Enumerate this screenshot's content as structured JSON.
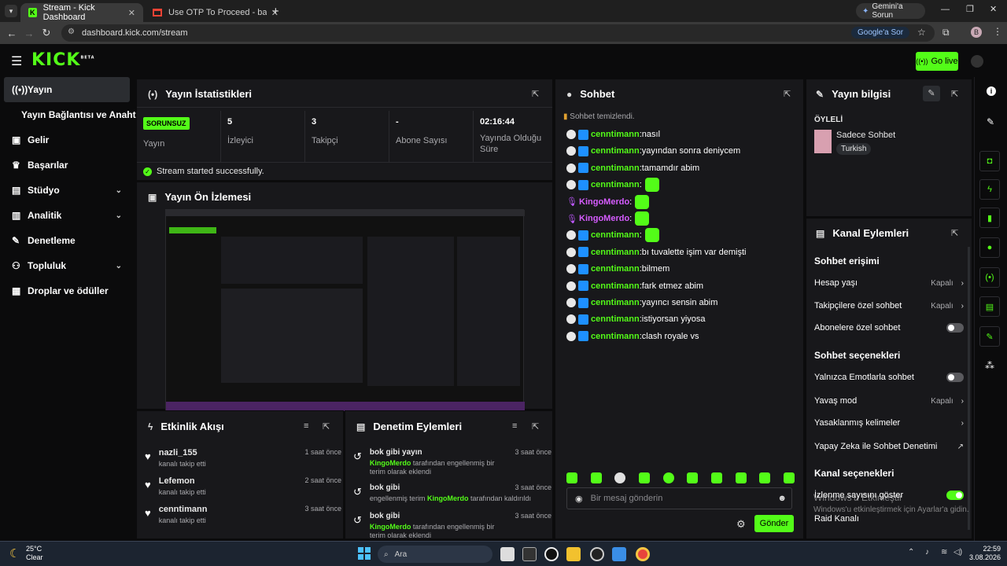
{
  "browser": {
    "tabs": [
      {
        "title": "Stream - Kick Dashboard"
      },
      {
        "title": "Use OTP To Proceed - babanne"
      }
    ],
    "gemini_button": "Gemini'a Sorun",
    "url": "dashboard.kick.com/stream",
    "google_pill": "Google'a Sor",
    "profile_initial": "B"
  },
  "header": {
    "logo": "KICK",
    "logo_beta": "BETA",
    "go_live": "Go live"
  },
  "sidebar": {
    "items": [
      {
        "label": "Yayın",
        "icon": "broadcast-icon"
      },
      {
        "label": "Yayın Bağlantısı ve Anahtarı",
        "icon": ""
      },
      {
        "label": "Gelir",
        "icon": "wallet-icon"
      },
      {
        "label": "Başarılar",
        "icon": "trophy-icon"
      },
      {
        "label": "Stüdyo",
        "icon": "studio-icon"
      },
      {
        "label": "Analitik",
        "icon": "chart-icon"
      },
      {
        "label": "Denetleme",
        "icon": "wrench-icon"
      },
      {
        "label": "Topluluk",
        "icon": "community-icon"
      },
      {
        "label": "Droplar ve ödüller",
        "icon": "gift-icon"
      }
    ]
  },
  "stats": {
    "title": "Yayın İstatistikleri",
    "status_badge": "SORUNSUZ",
    "status_label": "Yayın",
    "viewers": {
      "value": "5",
      "label": "İzleyici"
    },
    "followers": {
      "value": "3",
      "label": "Takipçi"
    },
    "subs": {
      "value": "-",
      "label": "Abone Sayısı"
    },
    "uptime": {
      "value": "02:16:44",
      "label": "Yayında Olduğu Süre"
    },
    "success": "Stream started successfully."
  },
  "preview": {
    "title": "Yayın Ön İzlemesi"
  },
  "activity": {
    "title": "Etkinlik Akışı",
    "items": [
      {
        "name": "nazli_155",
        "desc": "kanalı takip etti",
        "time": "1 saat önce"
      },
      {
        "name": "Lefemon",
        "desc": "kanalı takip etti",
        "time": "2 saat önce"
      },
      {
        "name": "cenntimann",
        "desc": "kanalı takip etti",
        "time": "3 saat önce"
      }
    ]
  },
  "moderation": {
    "title": "Denetim Eylemleri",
    "items": [
      {
        "title": "bok gibi yayın",
        "mod": "KingoMerdo",
        "desc": "tarafından engellenmiş bir terim olarak eklendi",
        "time": "3 saat önce"
      },
      {
        "title": "bok gibi",
        "prefix": "engellenmiş terim",
        "mod": "KingoMerdo",
        "desc": "tarafından kaldırıldı",
        "time": "3 saat önce"
      },
      {
        "title": "bok gibi",
        "mod": "KingoMerdo",
        "desc": "tarafından engellenmiş bir terim olarak eklendi",
        "time": "3 saat önce"
      }
    ]
  },
  "chat": {
    "title": "Sohbet",
    "cleared": "Sohbet temizlendi.",
    "messages": [
      {
        "user": "cenntimann",
        "text": "nasıl",
        "emote": false
      },
      {
        "user": "cenntimann",
        "text": "yayından sonra deniycem",
        "emote": false
      },
      {
        "user": "cenntimann",
        "text": "tamamdır abim",
        "emote": false
      },
      {
        "user": "cenntimann",
        "text": "",
        "emote": true
      },
      {
        "user": "KingoMerdo",
        "text": "",
        "emote": true
      },
      {
        "user": "KingoMerdo",
        "text": "",
        "emote": true
      },
      {
        "user": "cenntimann",
        "text": "",
        "emote": true
      },
      {
        "user": "cenntimann",
        "text": "bı tuvalette işim var demişti",
        "emote": false
      },
      {
        "user": "cenntimann",
        "text": "bilmem",
        "emote": false
      },
      {
        "user": "cenntimann",
        "text": "fark etmez abim",
        "emote": false
      },
      {
        "user": "cenntimann",
        "text": "yayıncı sensin abim",
        "emote": false
      },
      {
        "user": "cenntimann",
        "text": "istiyorsan yiyosa",
        "emote": false
      },
      {
        "user": "cenntimann",
        "text": "clash royale vs",
        "emote": false
      }
    ],
    "input_placeholder": "Bir mesaj gönderin",
    "send": "Gönder"
  },
  "info": {
    "title": "Yayın bilgisi",
    "category_label": "ÖYLELİ",
    "stream_title": "Sadece Sohbet",
    "tag": "Turkish"
  },
  "channel": {
    "title": "Kanal Eylemleri",
    "access_head": "Sohbet erişimi",
    "account_age": {
      "label": "Hesap yaşı",
      "value": "Kapalı"
    },
    "followers_only": {
      "label": "Takipçilere özel sohbet",
      "value": "Kapalı"
    },
    "subs_only": {
      "label": "Abonelere özel sohbet"
    },
    "options_head": "Sohbet seçenekleri",
    "emote_only": {
      "label": "Yalnızca Emotlarla sohbet"
    },
    "slow_mode": {
      "label": "Yavaş mod",
      "value": "Kapalı"
    },
    "banned_words": {
      "label": "Yasaklanmış kelimeler"
    },
    "ai_mod": {
      "label": "Yapay Zeka ile Sohbet Denetimi"
    },
    "channel_head": "Kanal seçenekleri",
    "view_count": {
      "label": "İzlenme sayısını göster"
    },
    "raid": {
      "label": "Raid Kanalı"
    }
  },
  "watermark": {
    "line1": "Windows'u Etkinleştir",
    "line2": "Windows'u etkinleştirmek için Ayarlar'a gidin."
  },
  "taskbar": {
    "weather_temp": "25°C",
    "weather_desc": "Clear",
    "search": "Ara",
    "time": "22:59",
    "date": "3.08.2026"
  }
}
